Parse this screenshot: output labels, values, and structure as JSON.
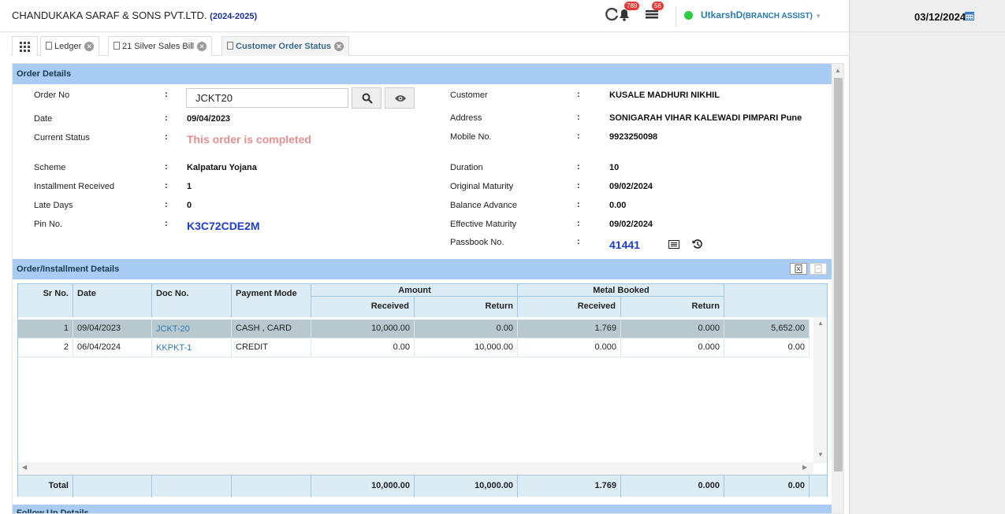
{
  "header": {
    "company": "CHANDUKAKA SARAF & SONS PVT.LTD.",
    "year": "(2024-2025)",
    "notifications_count": "789",
    "tasks_count": "56",
    "user": "UtkarshD",
    "role": "(BRANCH ASSIST)",
    "date": "03/12/2024"
  },
  "tabs": [
    {
      "label": "Ledger"
    },
    {
      "label": "21 Silver Sales Bill"
    },
    {
      "label": "Customer Order Status"
    }
  ],
  "order": {
    "section_title": "Order Details",
    "labels": {
      "order_no": "Order No",
      "date": "Date",
      "current_status": "Current Status",
      "scheme": "Scheme",
      "installment_received": "Installment Received",
      "late_days": "Late Days",
      "pin_no": "Pin No.",
      "customer": "Customer",
      "address": "Address",
      "mobile": "Mobile No.",
      "duration": "Duration",
      "original_maturity": "Original Maturity",
      "balance_advance": "Balance Advance",
      "effective_maturity": "Effective Maturity",
      "passbook": "Passbook No."
    },
    "colon": ":",
    "order_no": "JCKT20",
    "date": "09/04/2023",
    "current_status": "This order is completed",
    "scheme": "Kalpataru Yojana",
    "installment_received": "1",
    "late_days": "0",
    "pin_no": "K3C72CDE2M",
    "customer": "KUSALE MADHURI NIKHIL",
    "address": "SONIGARAH VIHAR KALEWADI PIMPARI Pune",
    "mobile": "9923250098",
    "duration": "10",
    "original_maturity": "09/02/2024",
    "balance_advance": "0.00",
    "effective_maturity": "09/02/2024",
    "passbook": "41441"
  },
  "installments": {
    "section_title": "Order/Installment Details",
    "headers": {
      "sr": "Sr No.",
      "date": "Date",
      "doc": "Doc No.",
      "mode": "Payment Mode",
      "amount": "Amount",
      "metal": "Metal Booked",
      "received": "Received",
      "return": "Return"
    },
    "rows": [
      {
        "sr": "1",
        "date": "09/04/2023",
        "doc": "JCKT-20",
        "mode": "CASH , CARD",
        "amt_rec": "10,000.00",
        "amt_ret": "0.00",
        "met_rec": "1.769",
        "met_ret": "0.000",
        "extra": "5,652.00"
      },
      {
        "sr": "2",
        "date": "06/04/2024",
        "doc": "KKPKT-1",
        "mode": "CREDIT",
        "amt_rec": "0.00",
        "amt_ret": "10,000.00",
        "met_rec": "0.000",
        "met_ret": "0.000",
        "extra": "0.00"
      }
    ],
    "total": {
      "label": "Total",
      "amt_rec": "10,000.00",
      "amt_ret": "10,000.00",
      "met_rec": "1.769",
      "met_ret": "0.000",
      "extra": "0.00"
    }
  },
  "followup": {
    "section_title": "Follow Up Details"
  }
}
